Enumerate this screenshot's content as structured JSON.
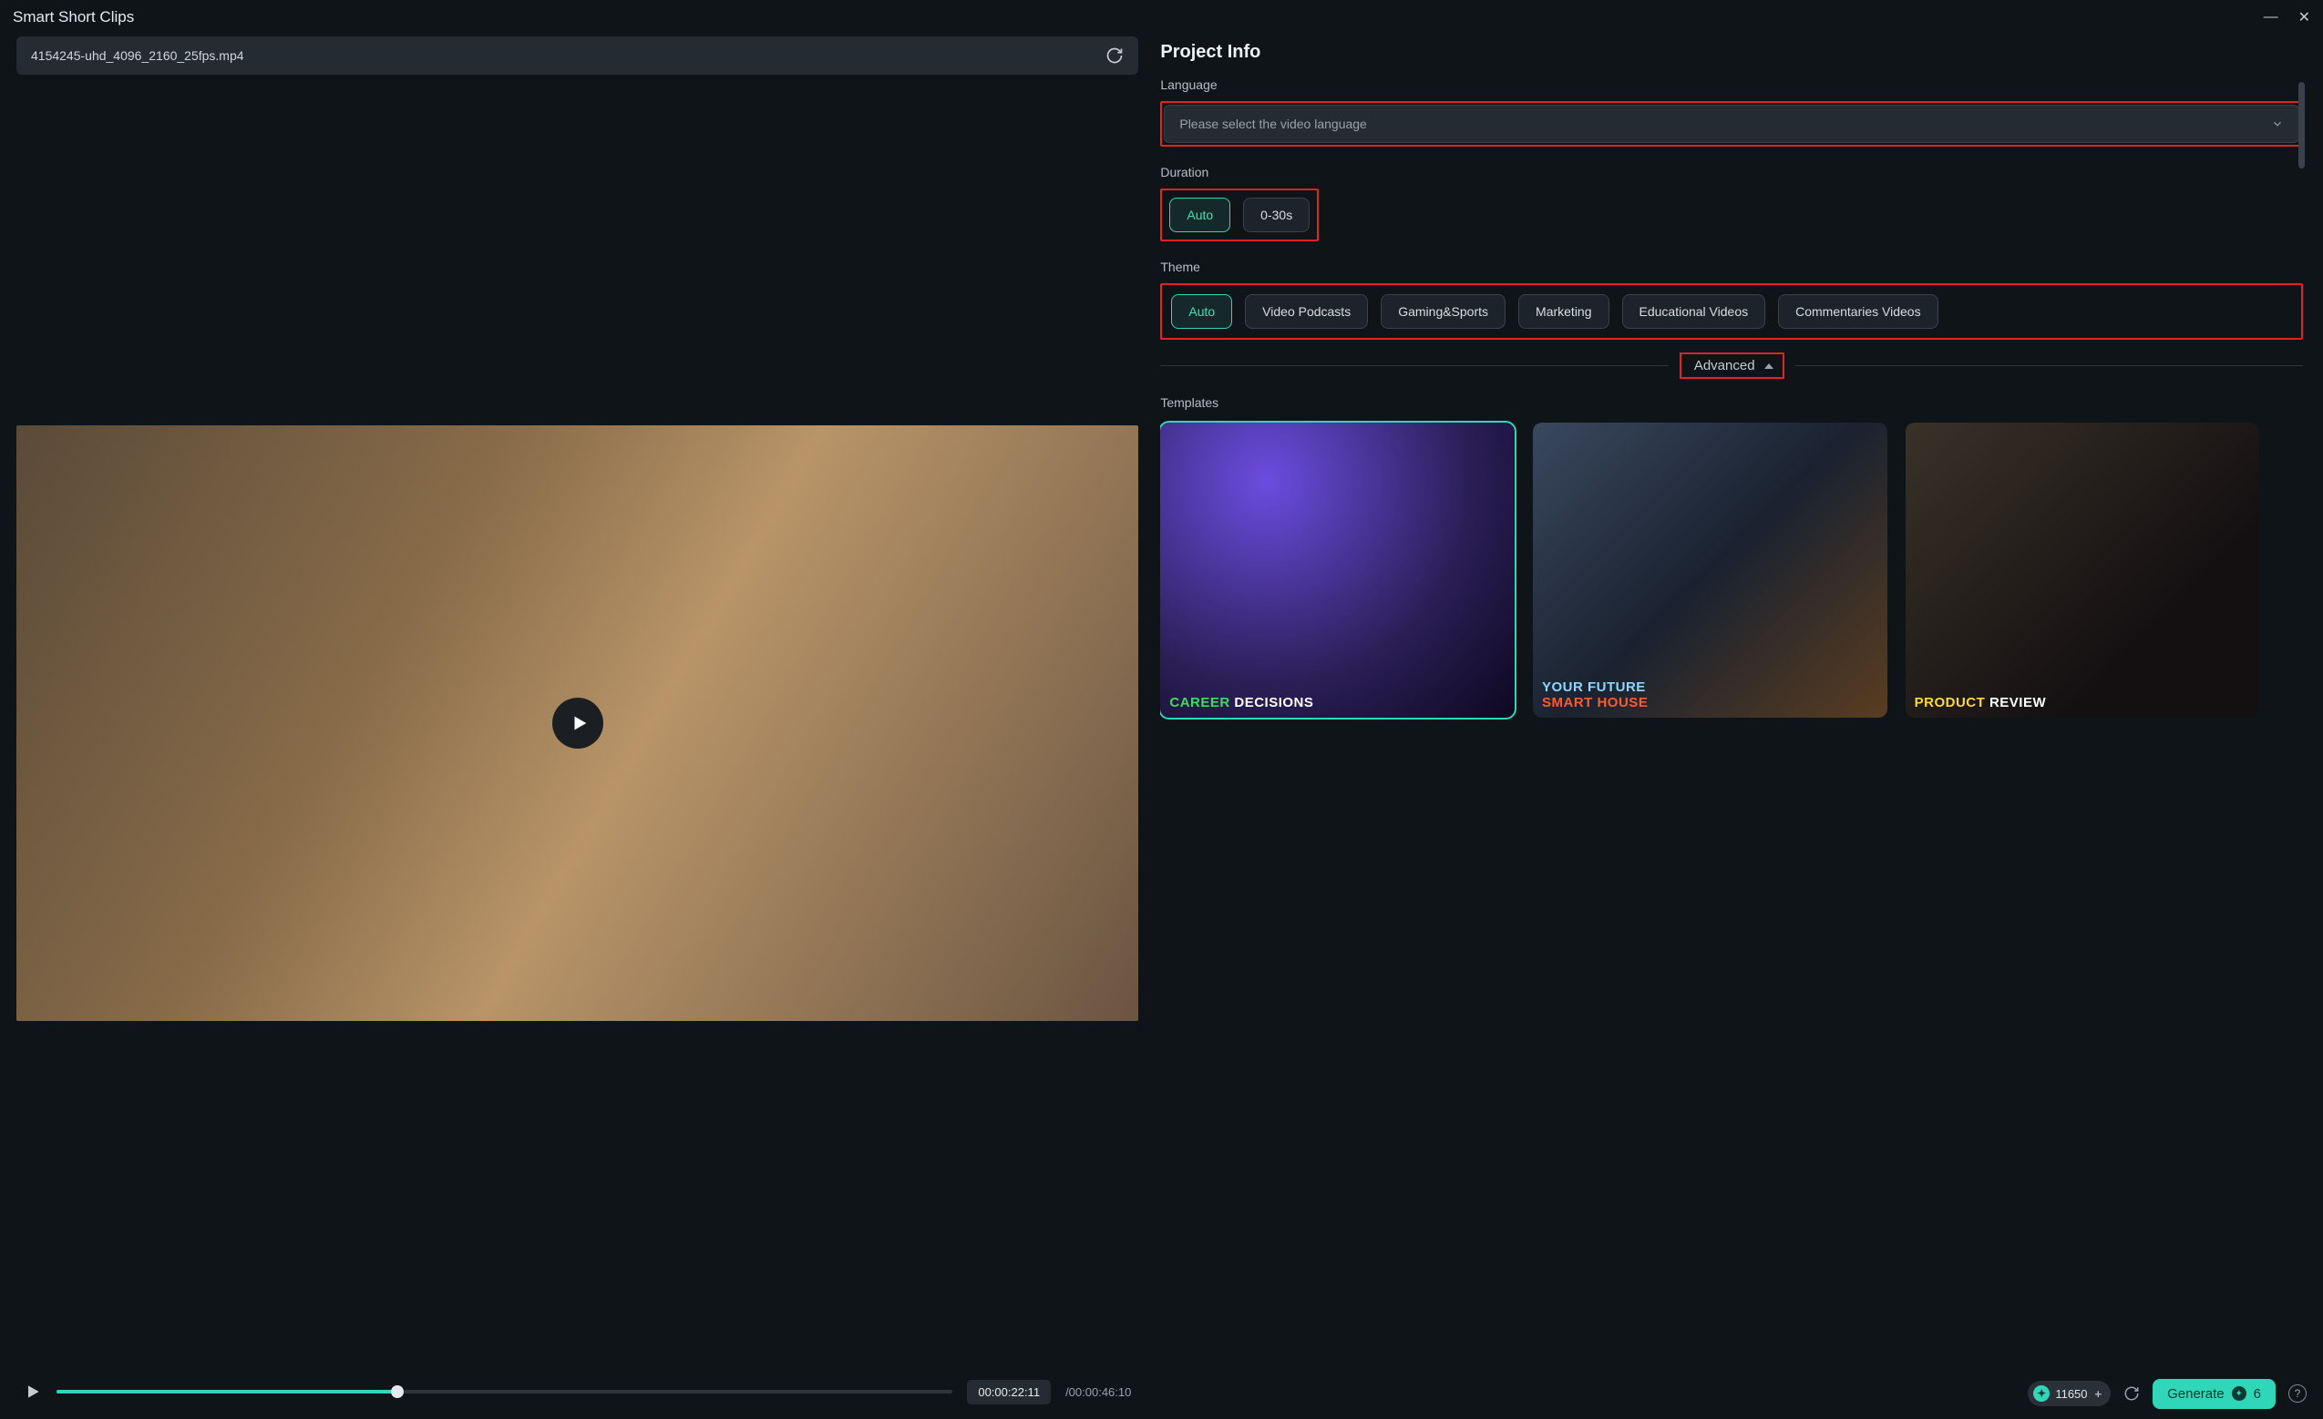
{
  "window": {
    "title": "Smart Short Clips"
  },
  "file": {
    "name": "4154245-uhd_4096_2160_25fps.mp4"
  },
  "transport": {
    "current": "00:00:22:11",
    "total": "/00:00:46:10"
  },
  "project": {
    "heading": "Project Info",
    "language_label": "Language",
    "language_placeholder": "Please select the video language",
    "duration_label": "Duration",
    "duration_options": [
      "Auto",
      "0-30s"
    ],
    "theme_label": "Theme",
    "theme_options": [
      "Auto",
      "Video Podcasts",
      "Gaming&Sports",
      "Marketing",
      "Educational Videos",
      "Commentaries Videos"
    ],
    "advanced_label": "Advanced",
    "templates_label": "Templates",
    "templates": [
      {
        "line1": "CAREER",
        "line2": "DECISIONS"
      },
      {
        "line1": "YOUR FUTURE",
        "line2": "SMART HOUSE"
      },
      {
        "line1": "PRODUCT",
        "line2": "REVIEW"
      }
    ]
  },
  "footer": {
    "coins": "11650",
    "generate_label": "Generate",
    "generate_cost": "6"
  }
}
